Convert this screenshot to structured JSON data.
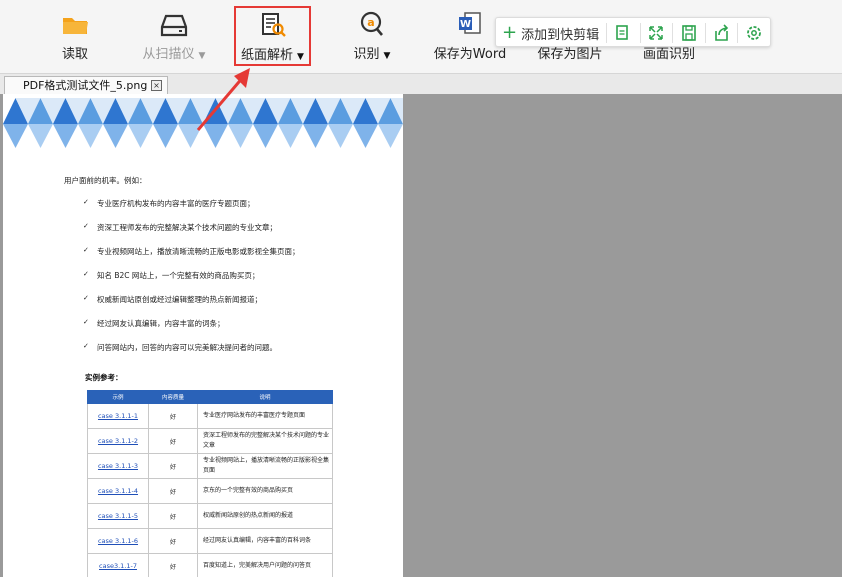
{
  "toolbar": {
    "buttons": [
      {
        "label": "读取",
        "icon": "folder-icon",
        "caret": ""
      },
      {
        "label": "从扫描仪",
        "icon": "scanner-icon",
        "caret": "▼"
      },
      {
        "label": "纸面解析",
        "icon": "page-analysis-icon",
        "caret": "▼"
      },
      {
        "label": "识别",
        "icon": "recognize-icon",
        "caret": "▼"
      },
      {
        "label": "保存为Word",
        "icon": "word-icon",
        "caret": ""
      },
      {
        "label": "保存为图片",
        "icon": "image-icon",
        "caret": ""
      },
      {
        "label": "画面识别",
        "icon": "screen-recognize-icon",
        "caret": ""
      }
    ]
  },
  "quickbar": {
    "add_label": "添加到快剪辑",
    "icons": [
      "copy-icon",
      "fullscreen-icon",
      "save-icon",
      "share-icon",
      "settings-icon"
    ]
  },
  "tab": {
    "filename": "PDF格式测试文件_5.png",
    "close": "×"
  },
  "document": {
    "intro": "用户面前的机率。例如：",
    "bullets": [
      "专业医疗机构发布的内容丰富的医疗专题页面；",
      "资深工程师发布的完整解决某个技术问题的专业文章；",
      "专业视频网站上，播放清晰流畅的正版电影或影视全集页面；",
      "知名 B2C 网站上，一个完整有效的商品购买页；",
      "权威新闻站原创或经过编辑整理的热点新闻报道；",
      "经过网友认真编辑，内容丰富的词条；",
      "问答网站内，回答的内容可以完美解决提问者的问题。"
    ],
    "example_heading": "实例参考：",
    "table": {
      "headers": [
        "示例",
        "内容质量",
        "说明"
      ],
      "rows": [
        [
          "case 3.1.1-1",
          "好",
          "专业医疗网站发布的丰富医疗专题页面"
        ],
        [
          "case 3.1.1-2",
          "好",
          "资深工程师发布的完整解决某个技术问题的专业文章"
        ],
        [
          "case 3.1.1-3",
          "好",
          "专业视频网站上，播放清晰流畅的正版影视全集页面"
        ],
        [
          "case 3.1.1-4",
          "好",
          "京东的一个完整有效的商品购买页"
        ],
        [
          "case 3.1.1-5",
          "好",
          "权威新闻站原创的热点新闻的报道"
        ],
        [
          "case 3.1.1-6",
          "好",
          "经过网友认真编辑，内容丰富的百科词条"
        ],
        [
          "case3.1.1-7",
          "好",
          "百度知道上，完美解决用户问题的问答页"
        ]
      ]
    }
  },
  "colors": {
    "highlight": "#e53935",
    "accent_blue": "#2a62b8",
    "quick_green": "#2da44e"
  }
}
